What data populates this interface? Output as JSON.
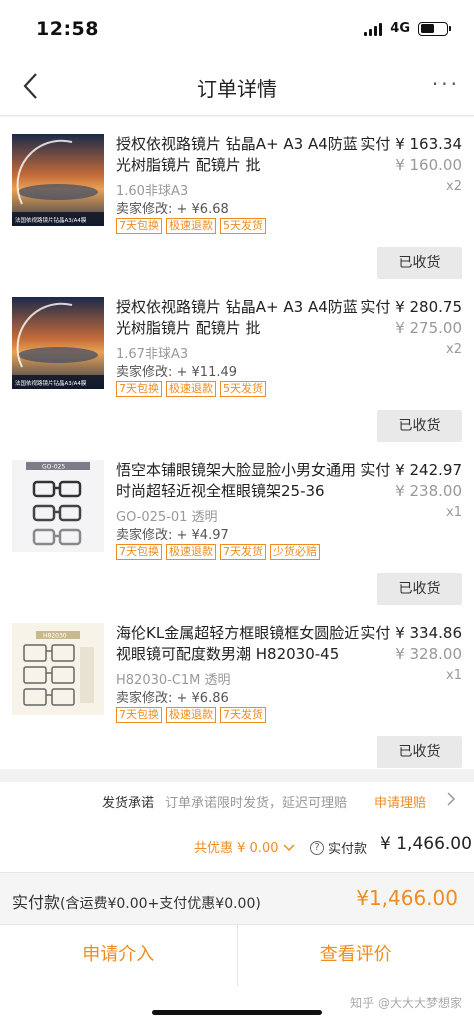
{
  "status_bar": {
    "time": "12:58",
    "network": "4G",
    "battery_level": 0.55
  },
  "nav": {
    "title": "订单详情",
    "more": "···"
  },
  "items": [
    {
      "thumb_type": "lens",
      "name": "授权依视路镜片 钻晶A+ A3 A4防蓝光树脂镜片 配镜片 批",
      "price_label": "实付",
      "price": "¥ 163.34",
      "original_price": "¥ 160.00",
      "qty": "x2",
      "sku": "1.60非球A3",
      "adjust": "卖家修改: + ¥6.68",
      "tags": [
        "7天包换",
        "极速退款",
        "5天发货"
      ],
      "button": "已收货",
      "thumb_caption": "法国依视路镜片钻晶A3/A4膜"
    },
    {
      "thumb_type": "lens",
      "name": "授权依视路镜片 钻晶A+ A3 A4防蓝光树脂镜片 配镜片 批",
      "price_label": "实付",
      "price": "¥ 280.75",
      "original_price": "¥ 275.00",
      "qty": "x2",
      "sku": "1.67非球A3",
      "adjust": "卖家修改: + ¥11.49",
      "tags": [
        "7天包换",
        "极速退款",
        "5天发货"
      ],
      "button": "已收货",
      "thumb_caption": "法国依视路镜片钻晶A3/A4膜"
    },
    {
      "thumb_type": "frame",
      "name": "悟空本铺眼镜架大脸显脸小男女通用时尚超轻近视全框眼镜架25-36",
      "price_label": "实付",
      "price": "¥ 242.97",
      "original_price": "¥ 238.00",
      "qty": "x1",
      "sku": "GO-025-01 透明",
      "adjust": "卖家修改: + ¥4.97",
      "tags": [
        "7天包换",
        "极速退款",
        "7天发货",
        "少货必赔"
      ],
      "button": "已收货",
      "thumb_caption": "GO-025"
    },
    {
      "thumb_type": "frame2",
      "name": "海伦KL金属超轻方框眼镜框女圆脸近视眼镜可配度数男潮 H82030-45",
      "price_label": "实付",
      "price": "¥ 334.86",
      "original_price": "¥ 328.00",
      "qty": "x1",
      "sku": "H82030-C1M 透明",
      "adjust": "卖家修改: + ¥6.86",
      "tags": [
        "7天包换",
        "极速退款",
        "7天发货"
      ],
      "button": "已收货",
      "thumb_caption": "H82030"
    }
  ],
  "promise": {
    "label": "发货承诺",
    "desc": "订单承诺限时发货，延迟可理赔",
    "link": "申请理赔"
  },
  "summary": {
    "discount": "共优惠 ¥ 0.00",
    "paid_label": "实付款",
    "paid_amount": "¥ 1,466.00"
  },
  "total_bar": {
    "label": "实付款",
    "detail": "(含运费¥0.00+支付优惠¥0.00)",
    "amount": "¥1,466.00"
  },
  "actions": {
    "intervene": "申请介入",
    "review": "查看评价"
  },
  "watermark": "知乎 @大大大梦想家",
  "colors": {
    "accent": "#f08c1f",
    "muted": "#999999"
  }
}
